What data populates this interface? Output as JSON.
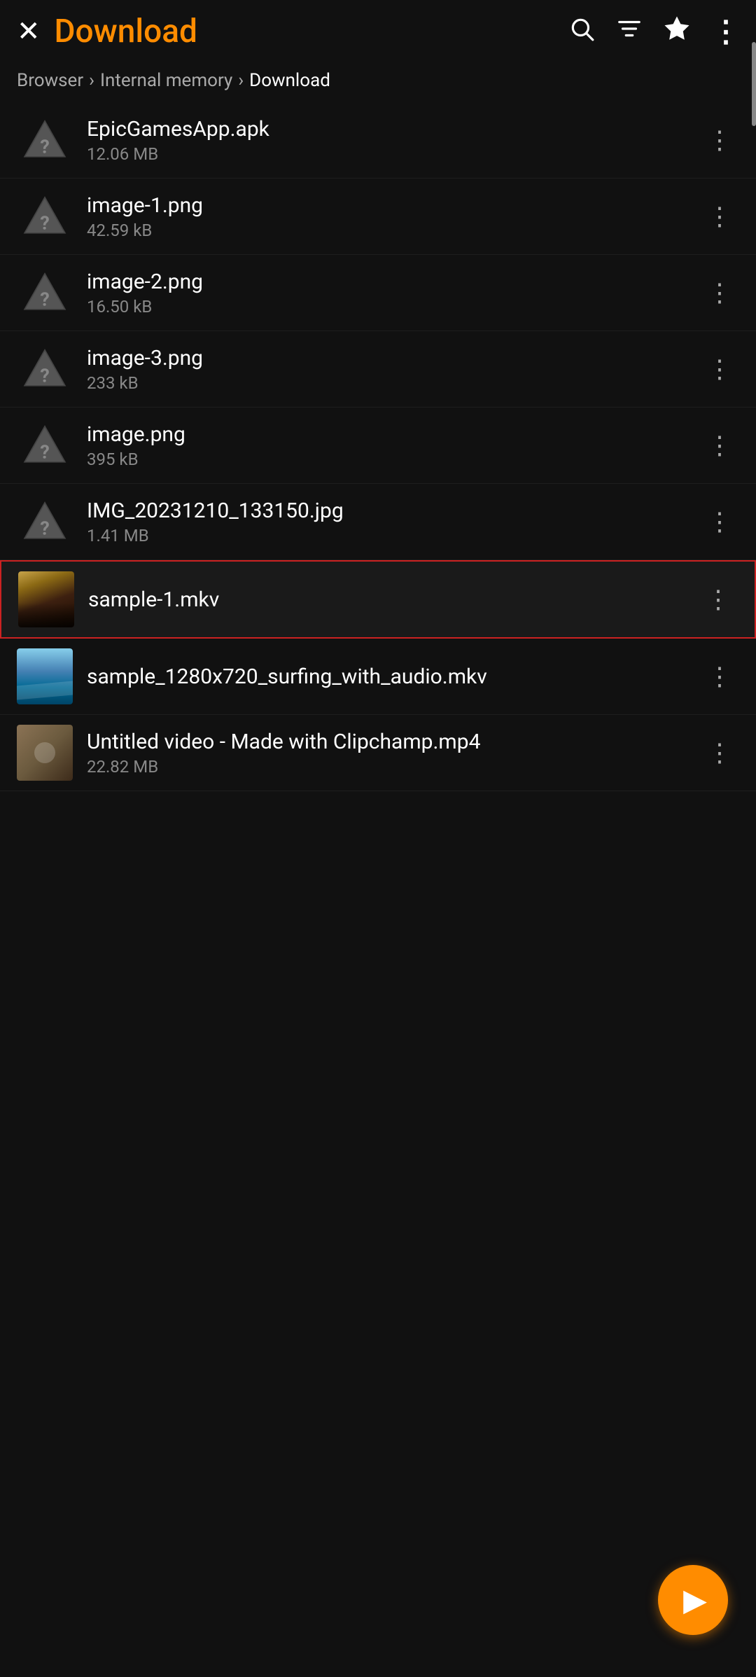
{
  "header": {
    "title": "Download",
    "close_label": "×"
  },
  "breadcrumb": {
    "items": [
      {
        "label": "Browser",
        "active": false
      },
      {
        "label": "Internal memory",
        "active": false
      },
      {
        "label": "Download",
        "active": true
      }
    ]
  },
  "files": [
    {
      "id": "epicgames",
      "name": "EpicGamesApp.apk",
      "size": "12.06 MB",
      "type": "unknown",
      "selected": false
    },
    {
      "id": "image1",
      "name": "image-1.png",
      "size": "42.59 kB",
      "type": "unknown",
      "selected": false
    },
    {
      "id": "image2",
      "name": "image-2.png",
      "size": "16.50 kB",
      "type": "unknown",
      "selected": false
    },
    {
      "id": "image3",
      "name": "image-3.png",
      "size": "233 kB",
      "type": "unknown",
      "selected": false
    },
    {
      "id": "image",
      "name": "image.png",
      "size": "395 kB",
      "type": "unknown",
      "selected": false
    },
    {
      "id": "img20231210",
      "name": "IMG_20231210_133150.jpg",
      "size": "1.41 MB",
      "type": "unknown",
      "selected": false
    },
    {
      "id": "sample1mkv",
      "name": "sample-1.mkv",
      "size": "",
      "type": "video-mkv1",
      "selected": true
    },
    {
      "id": "samplesurfing",
      "name": "sample_1280x720_surfing_with_audio.mkv",
      "size": "",
      "type": "video-surf",
      "selected": false
    },
    {
      "id": "untitledvideo",
      "name": "Untitled video - Made with Clipchamp.mp4",
      "size": "22.82 MB",
      "type": "video-clipchamp",
      "selected": false
    }
  ],
  "fab": {
    "label": "▶"
  },
  "icons": {
    "search": "🔍",
    "filter": "☰",
    "star": "★",
    "more_vert": "⋮",
    "play": "▶"
  }
}
